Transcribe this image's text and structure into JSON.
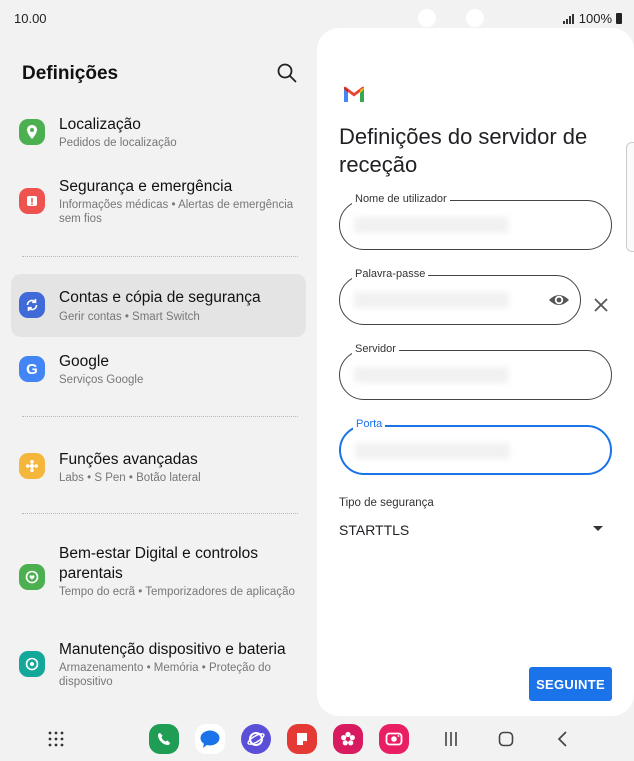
{
  "status": {
    "time": "10.00",
    "battery": "100%"
  },
  "settings": {
    "title": "Definições",
    "items": [
      {
        "title": "Localização",
        "subtitle": "Pedidos de localização",
        "icon": "location-icon",
        "color": "#4caf50"
      },
      {
        "title": "Segurança e emergência",
        "subtitle": "Informações médicas • Alertas de emergência sem fios",
        "icon": "emergency-icon",
        "color": "#ef5350"
      },
      {
        "title": "Contas e cópia de segurança",
        "subtitle": "Gerir contas • Smart Switch",
        "icon": "sync-icon",
        "color": "#3f6ad8"
      },
      {
        "title": "Google",
        "subtitle": "Serviços Google",
        "icon": "google-icon",
        "color": "#4285f4"
      },
      {
        "title": "Funções avançadas",
        "subtitle": "Labs • S Pen • Botão lateral",
        "icon": "puzzle-icon",
        "color": "#f5b73b"
      },
      {
        "title": "Bem-estar Digital e controlos parentais",
        "subtitle": "Tempo do ecrã • Temporizadores de aplicação",
        "icon": "wellbeing-icon",
        "color": "#4caf50"
      },
      {
        "title": "Manutenção dispositivo e bateria",
        "subtitle": "Armazenamento • Memória • Proteção do dispositivo",
        "icon": "device-care-icon",
        "color": "#14a89a"
      }
    ]
  },
  "form": {
    "heading": "Definições do servidor de receção",
    "fields": {
      "username": "Nome de utilizador",
      "password": "Palavra-passe",
      "server": "Servidor",
      "port": "Porta"
    },
    "security_label": "Tipo de segurança",
    "security_value": "STARTTLS",
    "next_label": "SEGUINTE"
  },
  "colors": {
    "accent": "#1a73e8",
    "active_row": "#e4e4e4"
  }
}
